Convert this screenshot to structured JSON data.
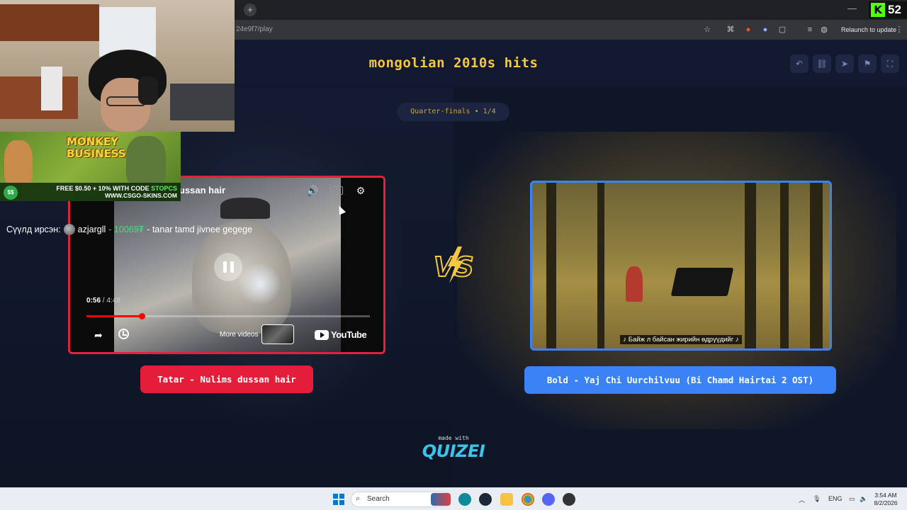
{
  "browser": {
    "url": "24e9f7/play",
    "relaunch_label": "Relaunch to update",
    "new_tab_label": "+",
    "minimize_label": "—",
    "kick_logo": "K",
    "viewer_count": "52"
  },
  "quiz": {
    "title": "mongolian 2010s hits",
    "round": "Quarter-finals • 1/4",
    "left_answer": "Tatar - Nulims dussan hair",
    "right_answer": "Bold - Yaj Chi Uurchilvuu (Bi Chamd Hairtai 2 OST)",
    "made_with": "made with",
    "brand": "QUIZEI",
    "header_buttons": [
      "undo-icon",
      "link-icon",
      "send-icon",
      "flag-icon",
      "fullscreen-icon"
    ]
  },
  "youtube": {
    "title": "ussan hair",
    "current_time": "0:56",
    "duration": " / 4:48",
    "progress_fraction": 0.194,
    "more_videos": "More videos",
    "logo_text": "YouTube",
    "cc_label": "CC"
  },
  "right_video": {
    "subtitle": "♪ Байж л байсан жирийн өдрүүдийг ♪"
  },
  "overlay": {
    "ad_title": "MONKEY BUSINESS",
    "ad_coin": "$$",
    "ad_promo_prefix": "FREE $0.50 + 10% WITH CODE ",
    "ad_code": "STOPCS",
    "ad_site": "WWW.CSGO-SKINS.COM",
    "chat_label": "Сүүлд ирсэн:",
    "chat_user": "azjargll",
    "chat_amount": " - 10069₮",
    "chat_message": " - tanar tamd jivnee gegege"
  },
  "taskbar": {
    "search_placeholder": "Search",
    "language": "ENG",
    "time": "3:54 AM",
    "date": "8/2/2026"
  },
  "colors": {
    "accent_yellow": "#f5c842",
    "left_red": "#e41e3a",
    "right_blue": "#3b82f6",
    "brand_cyan": "#3ec2ea"
  }
}
